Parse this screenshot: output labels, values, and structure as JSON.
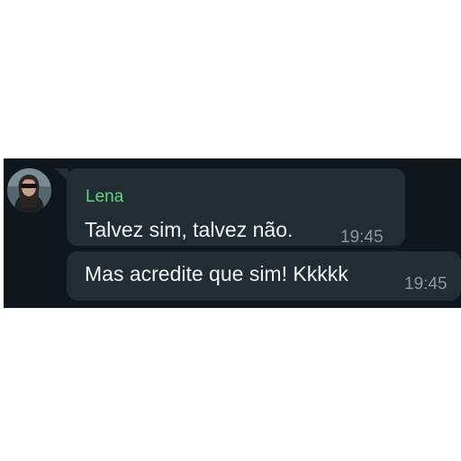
{
  "colors": {
    "panel_background": "#10171c",
    "bubble_background": "#222d33",
    "sender_name": "#63d27a",
    "message_text": "#f3f5f6",
    "timestamp": "#8a989f"
  },
  "messages": [
    {
      "sender": "Lena",
      "text": "Talvez sim, talvez não.",
      "time": "19:45",
      "avatar_icon": "contact-avatar-photo"
    },
    {
      "text": "Mas acredite que sim! Kkkkk",
      "time": "19:45"
    }
  ]
}
